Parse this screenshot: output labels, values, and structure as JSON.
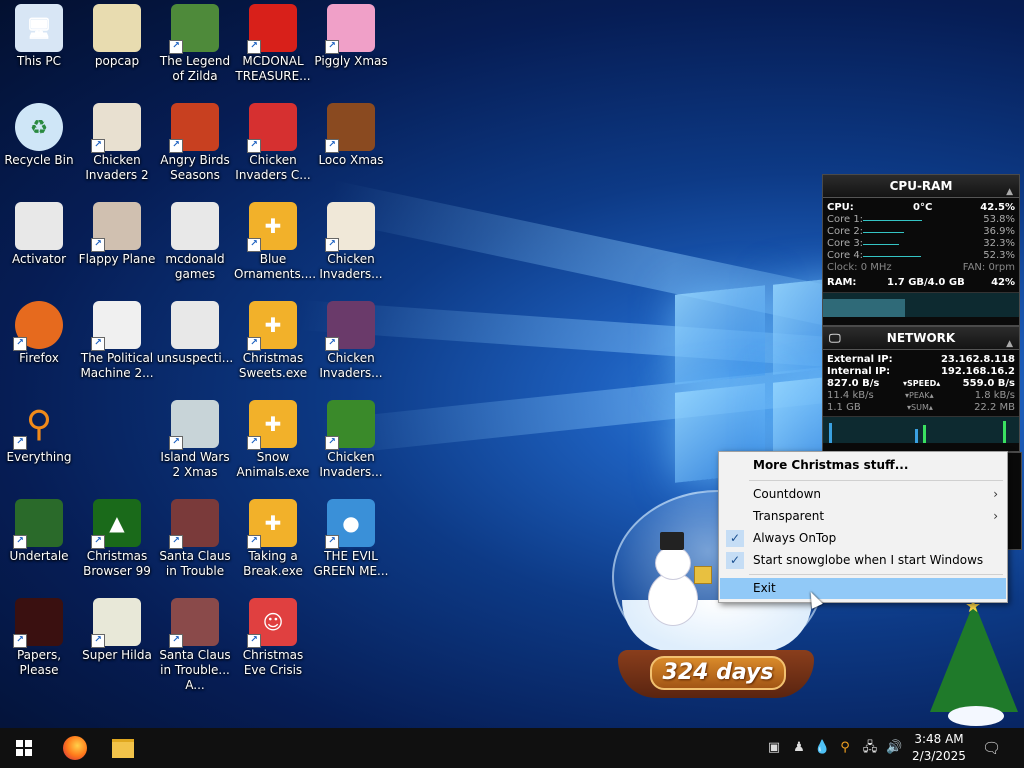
{
  "desktop": {
    "icons": [
      {
        "label": "This PC",
        "icon": "computer-icon",
        "color": "#d8e6f5"
      },
      {
        "label": "popcap",
        "icon": "folder-icon",
        "color": "#e8dcb0"
      },
      {
        "label": "The Legend of Zilda",
        "icon": "game-icon",
        "color": "#4e8a3a"
      },
      {
        "label": "MCDONAL TREASURE...",
        "icon": "game-icon",
        "color": "#d8201a"
      },
      {
        "label": "Piggly Xmas",
        "icon": "game-icon",
        "color": "#f0a0c8"
      },
      {
        "label": "Recycle Bin",
        "icon": "recycle-bin-icon",
        "color": "#cfe6f7"
      },
      {
        "label": "Chicken Invaders 2",
        "icon": "game-icon",
        "color": "#e8e0d0"
      },
      {
        "label": "Angry Birds Seasons",
        "icon": "game-icon",
        "color": "#c84020"
      },
      {
        "label": "Chicken Invaders C...",
        "icon": "game-icon",
        "color": "#d63030"
      },
      {
        "label": "Loco Xmas",
        "icon": "game-icon",
        "color": "#8a4a20"
      },
      {
        "label": "Activator",
        "icon": "file-icon",
        "color": "#e8e8e8"
      },
      {
        "label": "Flappy Plane",
        "icon": "game-icon",
        "color": "#d0c0b0"
      },
      {
        "label": "mcdonald games",
        "icon": "file-icon",
        "color": "#e8e8e8"
      },
      {
        "label": "Blue Ornaments....",
        "icon": "puzzle-icon",
        "color": "#f2b12a"
      },
      {
        "label": "Chicken Invaders...",
        "icon": "game-icon",
        "color": "#f0e8d8"
      },
      {
        "label": "Firefox",
        "icon": "firefox-icon",
        "color": "#e66a1e"
      },
      {
        "label": "The Political Machine 2...",
        "icon": "game-icon",
        "color": "#f0f0f0"
      },
      {
        "label": "unsuspecti...",
        "icon": "file-icon",
        "color": "#e8e8e8"
      },
      {
        "label": "Christmas Sweets.exe",
        "icon": "puzzle-icon",
        "color": "#f2b12a"
      },
      {
        "label": "Chicken Invaders...",
        "icon": "game-icon",
        "color": "#6a3a6a"
      },
      {
        "label": "Everything",
        "icon": "search-icon",
        "color": "#f08a1a"
      },
      {
        "label": "Island Wars 2 Xmas",
        "icon": "game-icon",
        "color": "#c8d4d8"
      },
      {
        "label": "Snow Animals.exe",
        "icon": "puzzle-icon",
        "color": "#f2b12a"
      },
      {
        "label": "Chicken Invaders...",
        "icon": "game-icon",
        "color": "#3a8a2a"
      },
      {
        "label": "Undertale",
        "icon": "game-icon",
        "color": "#2a6a2a"
      },
      {
        "label": "Christmas Browser 99",
        "icon": "tree-icon",
        "color": "#1a6a1a"
      },
      {
        "label": "Santa Claus in Trouble",
        "icon": "game-icon",
        "color": "#7a3a3a"
      },
      {
        "label": "Taking a Break.exe",
        "icon": "puzzle-icon",
        "color": "#f2b12a"
      },
      {
        "label": "THE EVIL GREEN ME...",
        "icon": "messenger-icon",
        "color": "#3a90d8"
      },
      {
        "label": "Papers, Please",
        "icon": "game-icon",
        "color": "#3a1010"
      },
      {
        "label": "Super Hilda",
        "icon": "game-icon",
        "color": "#e8e8d8"
      },
      {
        "label": "Santa Claus in Trouble... A...",
        "icon": "game-icon",
        "color": "#8a4a4a"
      },
      {
        "label": "Christmas Eve Crisis",
        "icon": "santa-icon",
        "color": "#e04040"
      }
    ]
  },
  "cpu_widget": {
    "title": "CPU-RAM",
    "cpu_label": "CPU:",
    "cpu_temp": "0°C",
    "cpu_value": "42.5%",
    "cores": [
      {
        "label": "Core 1:",
        "value": "53.8%",
        "pct": 53.8
      },
      {
        "label": "Core 2:",
        "value": "36.9%",
        "pct": 36.9
      },
      {
        "label": "Core 3:",
        "value": "32.3%",
        "pct": 32.3
      },
      {
        "label": "Core 4:",
        "value": "52.3%",
        "pct": 52.3
      }
    ],
    "clock": "Clock: 0 MHz",
    "fan": "FAN: 0rpm",
    "ram_label": "RAM:",
    "ram_used": "1.7 GB/4.0 GB",
    "ram_pct": "42%"
  },
  "net_widget": {
    "title": "NETWORK",
    "ext_label": "External IP:",
    "ext_ip": "23.162.8.118",
    "int_label": "Internal IP:",
    "int_ip": "192.168.16.2",
    "speed_down": "827.0 B/s",
    "speed_label": "SPEED",
    "speed_up": "559.0 B/s",
    "peak_down": "11.4 kB/s",
    "peak_label": "PEAK",
    "peak_up": "1.8 kB/s",
    "sum_down": "1.1 GB",
    "sum_label": "SUM",
    "sum_up": "22.2 MB"
  },
  "context_menu": {
    "items": [
      {
        "label": "More Christmas stuff...",
        "bold": true
      },
      {
        "label": "Countdown",
        "submenu": true
      },
      {
        "label": "Transparent",
        "submenu": true
      },
      {
        "label": "Always OnTop",
        "checked": true
      },
      {
        "label": "Start snowglobe when I start Windows",
        "checked": true
      },
      {
        "label": "Exit",
        "highlighted": true
      }
    ]
  },
  "snowglobe": {
    "days_text": "324 days"
  },
  "taskbar": {
    "time": "3:48 AM",
    "date": "2/3/2025"
  }
}
